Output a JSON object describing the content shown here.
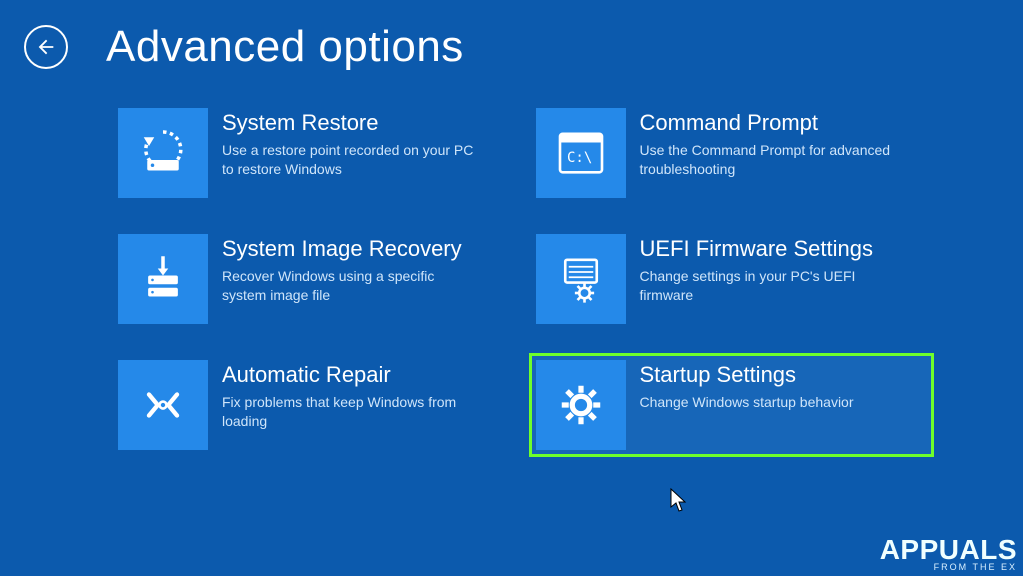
{
  "header": {
    "title": "Advanced options"
  },
  "tiles": {
    "system_restore": {
      "title": "System Restore",
      "desc": "Use a restore point recorded on your PC to restore Windows"
    },
    "command_prompt": {
      "title": "Command Prompt",
      "desc": "Use the Command Prompt for advanced troubleshooting"
    },
    "system_image_recovery": {
      "title": "System Image Recovery",
      "desc": "Recover Windows using a specific system image file"
    },
    "uefi_firmware": {
      "title": "UEFI Firmware Settings",
      "desc": "Change settings in your PC's UEFI firmware"
    },
    "automatic_repair": {
      "title": "Automatic Repair",
      "desc": "Fix problems that keep Windows from loading"
    },
    "startup_settings": {
      "title": "Startup Settings",
      "desc": "Change Windows startup behavior"
    }
  },
  "watermark": {
    "brand": "APPUALS",
    "sub": "FROM THE EX"
  }
}
